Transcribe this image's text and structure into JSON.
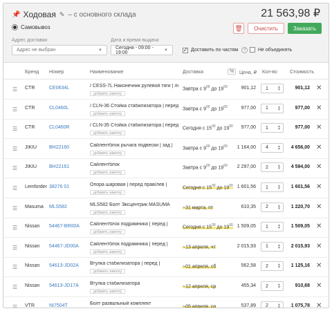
{
  "header": {
    "title": "Ходовая",
    "subtitle": "– с основного склада",
    "total": "21 563,98 ₽",
    "pin_icon": "pin-icon",
    "edit_icon": "pencil-icon"
  },
  "pickup": {
    "label": "Самовывоз"
  },
  "actions": {
    "clear_label": "Очистить",
    "order_label": "Заказать",
    "delete_icon": "trash-icon"
  },
  "filters": {
    "address_label": "Адрес доставки",
    "address_placeholder": "Адрес не выбран",
    "datetime_label": "Дата и время выдачи",
    "datetime_value": "Сегодня - 09:00 - 19:00",
    "partial_label": "Доставить по частям",
    "partial_checked": true,
    "no_merge_label": "Не объединять",
    "no_merge_checked": false
  },
  "columns": {
    "brand": "Бренд",
    "number": "Номер",
    "name": "Наименование",
    "delivery": "Доставка",
    "pct": "%",
    "price": "Цена, ₽",
    "qty": "Кол-во",
    "cost": "Стоимость"
  },
  "rows": [
    {
      "brand": "CTR",
      "number": "CE0634L",
      "name": "/ CESS-7L Наконечник рулевой тяги | ле...",
      "delivery_main": "Завтра с 9",
      "delivery_from_sup": "00",
      "delivery_mid": " до 19",
      "delivery_to_sup": "00",
      "highlight": false,
      "price": "901,12",
      "qty": "1",
      "cost": "901,12",
      "note": "добавить заметку"
    },
    {
      "brand": "CTR",
      "number": "CL0460L",
      "name": "/ CLN-36 Стойка стабилизатора | перед ...",
      "delivery_main": "Завтра с 9",
      "delivery_from_sup": "00",
      "delivery_mid": " до 19",
      "delivery_to_sup": "00",
      "highlight": false,
      "price": "977,00",
      "qty": "1",
      "cost": "977,00",
      "note": "добавить заметку"
    },
    {
      "brand": "CTR",
      "number": "CL0460R",
      "name": "/ CLN-35 Стойка стабилизатора | перед ...",
      "delivery_main": "Сегодня с 15",
      "delivery_from_sup": "30",
      "delivery_mid": " до 19",
      "delivery_to_sup": "00",
      "highlight": false,
      "price": "977,00",
      "qty": "1",
      "cost": "977,00",
      "note": "добавить заметку"
    },
    {
      "brand": "JIKIU",
      "number": "BH22160",
      "name": "Сайлентблок рычага подвески | зад |",
      "delivery_main": "Завтра с 9",
      "delivery_from_sup": "00",
      "delivery_mid": " до 19",
      "delivery_to_sup": "00",
      "highlight": false,
      "price": "1 164,00",
      "qty": "4",
      "cost": "4 656,00",
      "note": "добавить заметку"
    },
    {
      "brand": "JIKIU",
      "number": "BH22161",
      "name": "Сайлентблок",
      "delivery_main": "Завтра с 9",
      "delivery_from_sup": "00",
      "delivery_mid": " до 19",
      "delivery_to_sup": "00",
      "highlight": false,
      "price": "2 297,00",
      "qty": "2",
      "cost": "4 594,00",
      "note": "добавить заметку"
    },
    {
      "brand": "Lemforder",
      "number": "38276 01",
      "name": "Опора шаровая | перед прав/лев |",
      "delivery_main": "Сегодня с 15",
      "delivery_from_sup": "30",
      "delivery_mid": " до 19",
      "delivery_to_sup": "00",
      "highlight": true,
      "price": "1 601,56",
      "qty": "1",
      "cost": "1 601,56",
      "note": "добавить заметку"
    },
    {
      "brand": "Masuma",
      "number": "MLS582",
      "name": "MLS582 Болт Эксцентрик MASUMA",
      "delivery_main": "~31 марта, пт",
      "delivery_from_sup": "",
      "delivery_mid": "",
      "delivery_to_sup": "",
      "highlight": true,
      "price": "610,35",
      "qty": "2",
      "cost": "1 220,70",
      "note": "добавить заметку"
    },
    {
      "brand": "Nissan",
      "number": "54467-BR00A",
      "name": "Сайлентблок подрамника | перед |",
      "delivery_main": "Сегодня с 15",
      "delivery_from_sup": "30",
      "delivery_mid": " до 19",
      "delivery_to_sup": "00",
      "highlight": true,
      "price": "1 509,05",
      "qty": "1",
      "cost": "1 509,05",
      "note": "добавить заметку"
    },
    {
      "brand": "Nissan",
      "number": "54467-JD00A",
      "name": "Сайлентблок подрамника | перед |",
      "delivery_main": "~13 апреля, чт",
      "delivery_from_sup": "",
      "delivery_mid": "",
      "delivery_to_sup": "",
      "highlight": true,
      "price": "2 015,93",
      "qty": "1",
      "cost": "2 015,93",
      "note": "добавить заметку"
    },
    {
      "brand": "Nissan",
      "number": "54613-JD02A",
      "name": "Втулка стабилизатора | перед |",
      "delivery_main": "~01 апреля, сб",
      "delivery_from_sup": "",
      "delivery_mid": "",
      "delivery_to_sup": "",
      "highlight": true,
      "price": "562,58",
      "qty": "2",
      "cost": "1 125,16",
      "note": "добавить заметку"
    },
    {
      "brand": "Nissan",
      "number": "54613-JD17A",
      "name": "Втулка стабилизатора",
      "delivery_main": "~12 апреля, ср",
      "delivery_from_sup": "",
      "delivery_mid": "",
      "delivery_to_sup": "",
      "highlight": true,
      "price": "455,34",
      "qty": "2",
      "cost": "910,68",
      "note": "добавить заметку"
    },
    {
      "brand": "VTR",
      "number": "NI7504T",
      "name": "Болт развальный комплект",
      "delivery_main": "~05 апреля, ср",
      "delivery_from_sup": "",
      "delivery_mid": "",
      "delivery_to_sup": "",
      "highlight": true,
      "price": "537,89",
      "qty": "2",
      "cost": "1 075,78",
      "note": "добавить заметку"
    }
  ]
}
